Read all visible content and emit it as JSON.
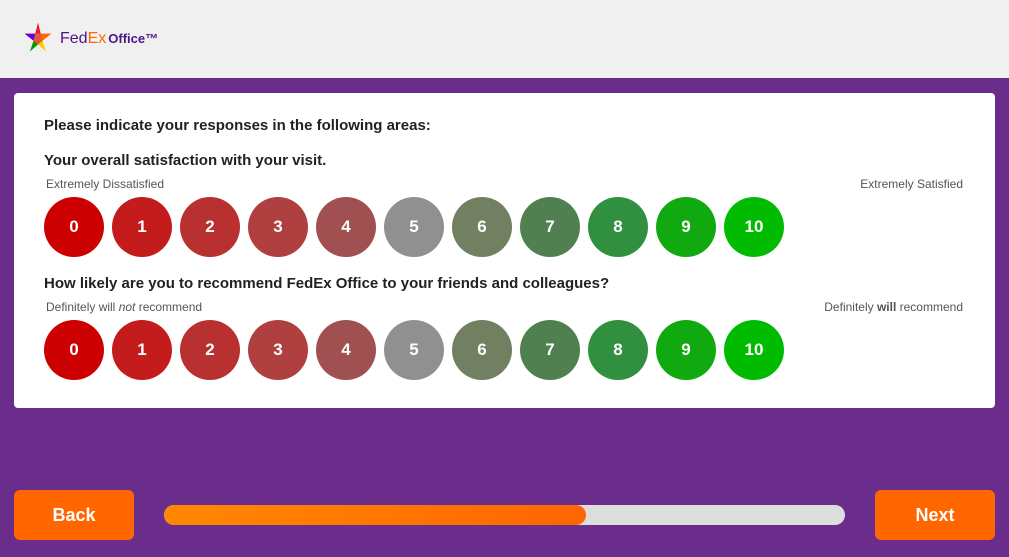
{
  "header": {
    "logo_fed": "Fed",
    "logo_ex": "Ex",
    "logo_office": "Office™"
  },
  "survey": {
    "instruction": "Please indicate your responses in the following areas:",
    "question1": {
      "label": "Your overall satisfaction with your visit.",
      "scale_left": "Extremely Dissatisfied",
      "scale_right": "Extremely Satisfied"
    },
    "question2": {
      "label": "How likely are you to recommend FedEx Office to your friends and colleagues?",
      "scale_left_prefix": "Definitely will ",
      "scale_left_italic": "not",
      "scale_left_suffix": " recommend",
      "scale_right_prefix": "Definitely ",
      "scale_right_italic": "will",
      "scale_right_suffix": " recommend"
    },
    "ratings": [
      0,
      1,
      2,
      3,
      4,
      5,
      6,
      7,
      8,
      9,
      10
    ]
  },
  "footer": {
    "back_label": "Back",
    "next_label": "Next",
    "progress_percent": 62
  }
}
